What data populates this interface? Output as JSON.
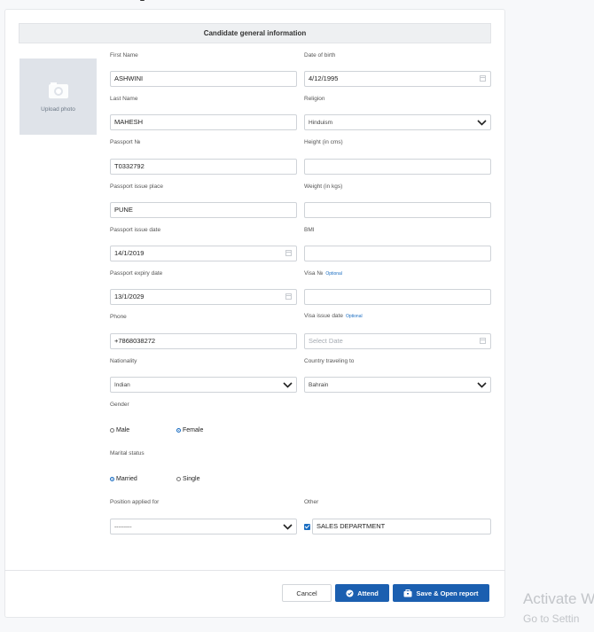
{
  "header": {
    "title": "Candidate general information"
  },
  "photo": {
    "label": "Upload photo"
  },
  "labels": {
    "first_name": "First Name",
    "date_of_birth": "Date of birth",
    "last_name": "Last Name",
    "religion": "Religion",
    "passport_no": "Passport №",
    "height": "Height (in cms)",
    "passport_issue_place": "Passport issue place",
    "weight": "Weight (in kgs)",
    "passport_issue_date": "Passport issue date",
    "bmi": "BMI",
    "passport_expiry_date": "Passport expiry date",
    "visa_no": "Visa №",
    "phone": "Phone",
    "visa_issue_date": "Visa issue date",
    "nationality": "Nationality",
    "country_traveling_to": "Country traveling to",
    "gender": "Gender",
    "marital_status": "Marital status",
    "position_applied_for": "Position applied for",
    "other": "Other",
    "optional": "Optional"
  },
  "values": {
    "first_name": "ASHWINI",
    "date_of_birth": "4/12/1995",
    "last_name": "MAHESH",
    "religion": "Hinduism",
    "passport_no": "T0332792",
    "height": "",
    "passport_issue_place": "PUNE",
    "weight": "",
    "passport_issue_date": "14/1/2019",
    "bmi": "",
    "passport_expiry_date": "13/1/2029",
    "visa_no": "",
    "phone": "+7868038272",
    "visa_issue_date_placeholder": "Select Date",
    "nationality": "Indian",
    "country_traveling_to": "Bahrain",
    "position_applied_for": "---------",
    "other": "SALES DEPARTMENT"
  },
  "gender": {
    "options": [
      "Male",
      "Female"
    ],
    "selected": "Female"
  },
  "marital": {
    "options": [
      "Married",
      "Single"
    ],
    "selected": "Married"
  },
  "other_checked": true,
  "buttons": {
    "cancel": "Cancel",
    "attend": "Attend",
    "save_open": "Save & Open report"
  },
  "watermark": {
    "line1": "Activate W",
    "line2": "Go to Settin"
  },
  "colors": {
    "accent": "#1b5fb0",
    "link": "#1b6ec2"
  }
}
